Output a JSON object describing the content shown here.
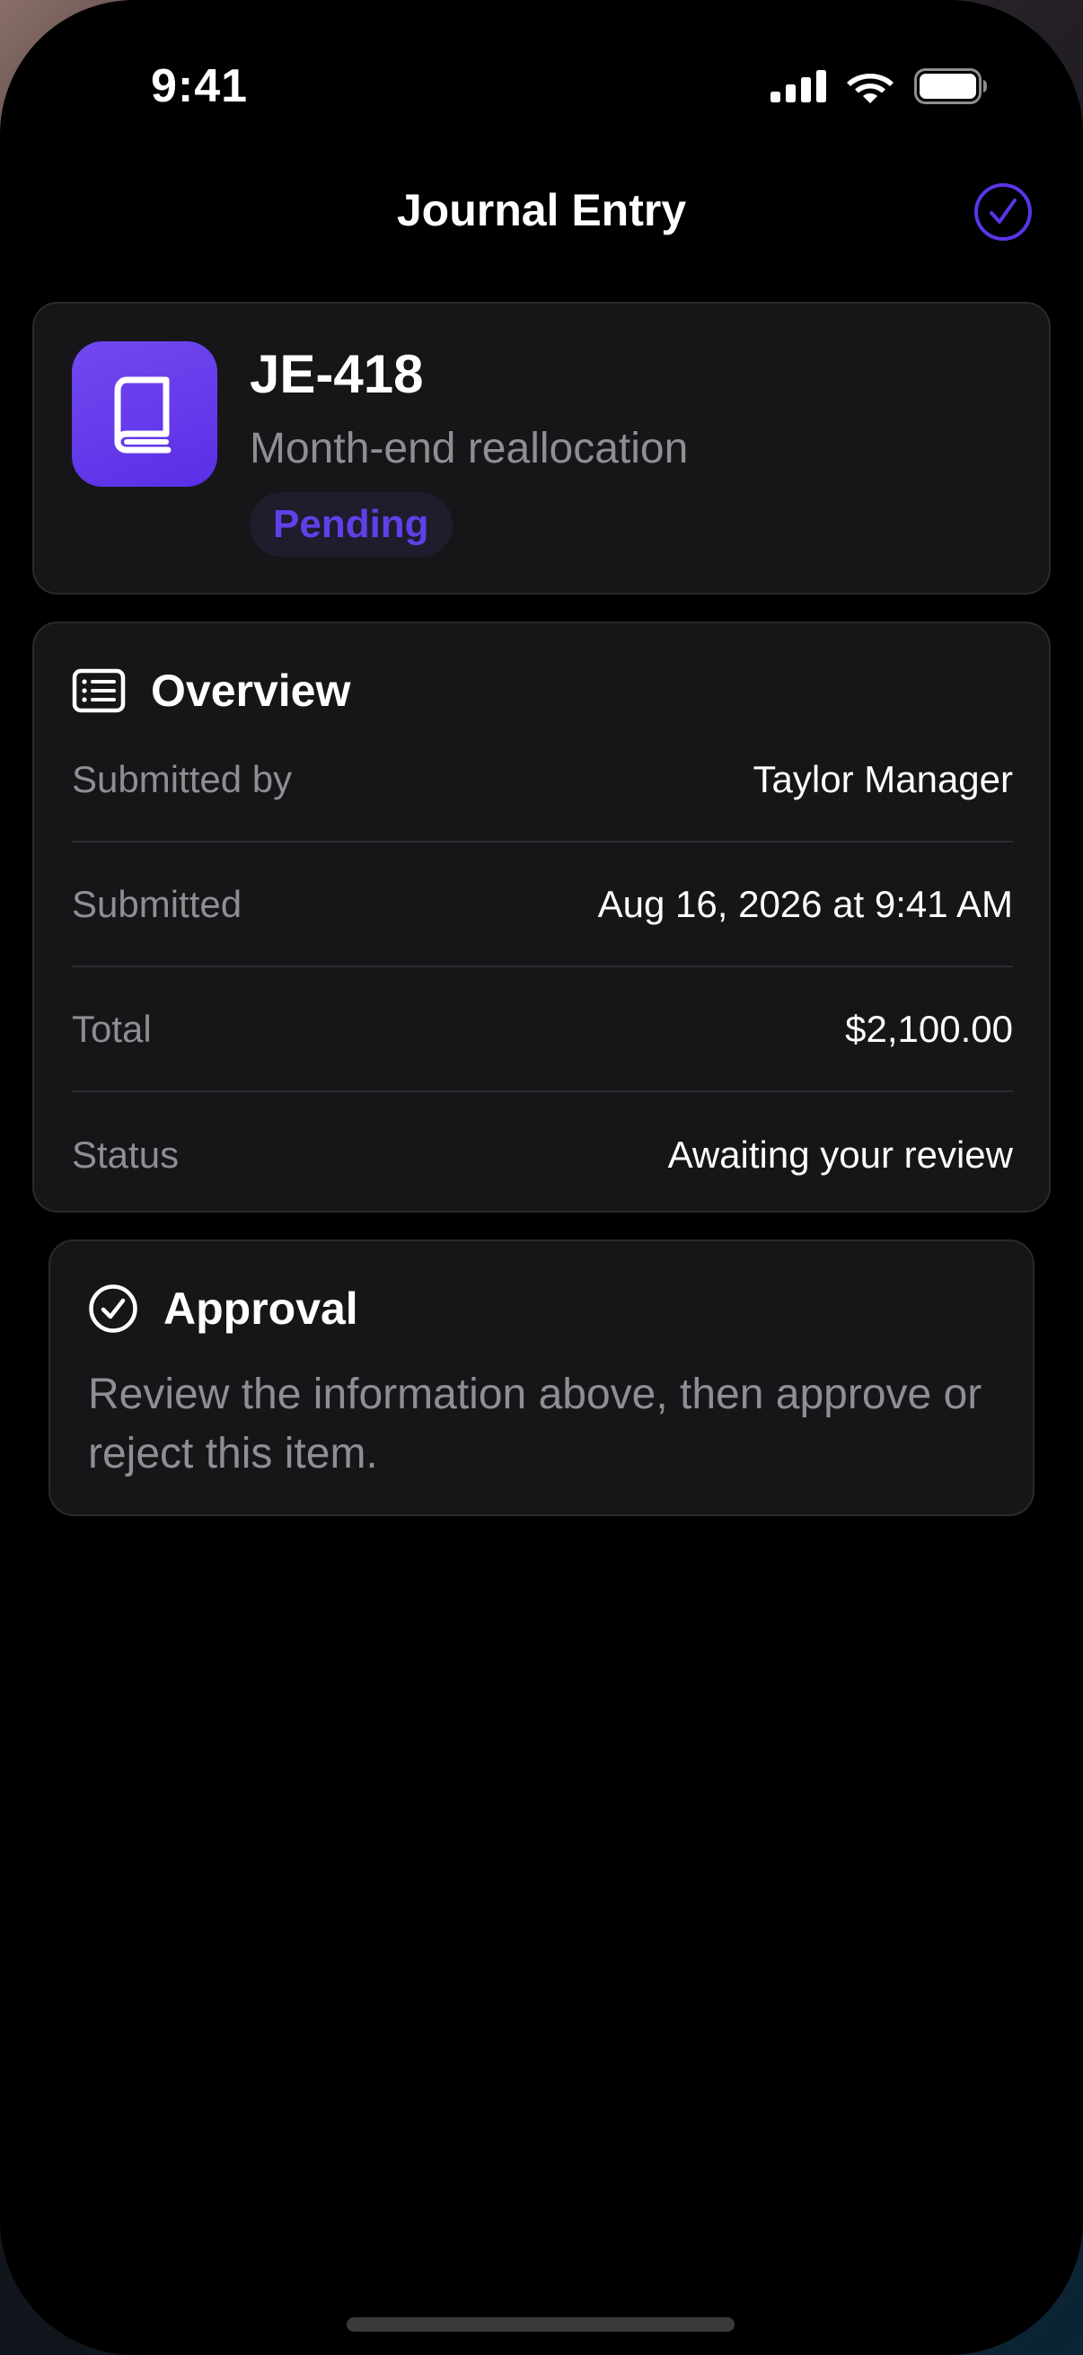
{
  "status_bar": {
    "time": "9:41"
  },
  "nav": {
    "title": "Journal Entry",
    "action_icon": "checkmark-circle-icon"
  },
  "header": {
    "icon": "book-icon",
    "id": "JE-418",
    "subtitle": "Month-end reallocation",
    "status": "Pending"
  },
  "overview": {
    "icon": "list-document-icon",
    "title": "Overview",
    "rows": [
      {
        "label": "Submitted by",
        "value": "Taylor Manager"
      },
      {
        "label": "Submitted",
        "value": "Aug 16, 2026 at 9:41 AM"
      },
      {
        "label": "Total",
        "value": "$2,100.00"
      },
      {
        "label": "Status",
        "value": "Awaiting your review"
      }
    ]
  },
  "approval": {
    "icon": "checkmark-circle-icon",
    "title": "Approval",
    "text": "Review the information above, then approve or reject this item."
  },
  "colors": {
    "accent": "#5a35e8",
    "pill_text": "#6040e8",
    "card_bg": "#161619",
    "secondary_text": "#8e8e93"
  }
}
